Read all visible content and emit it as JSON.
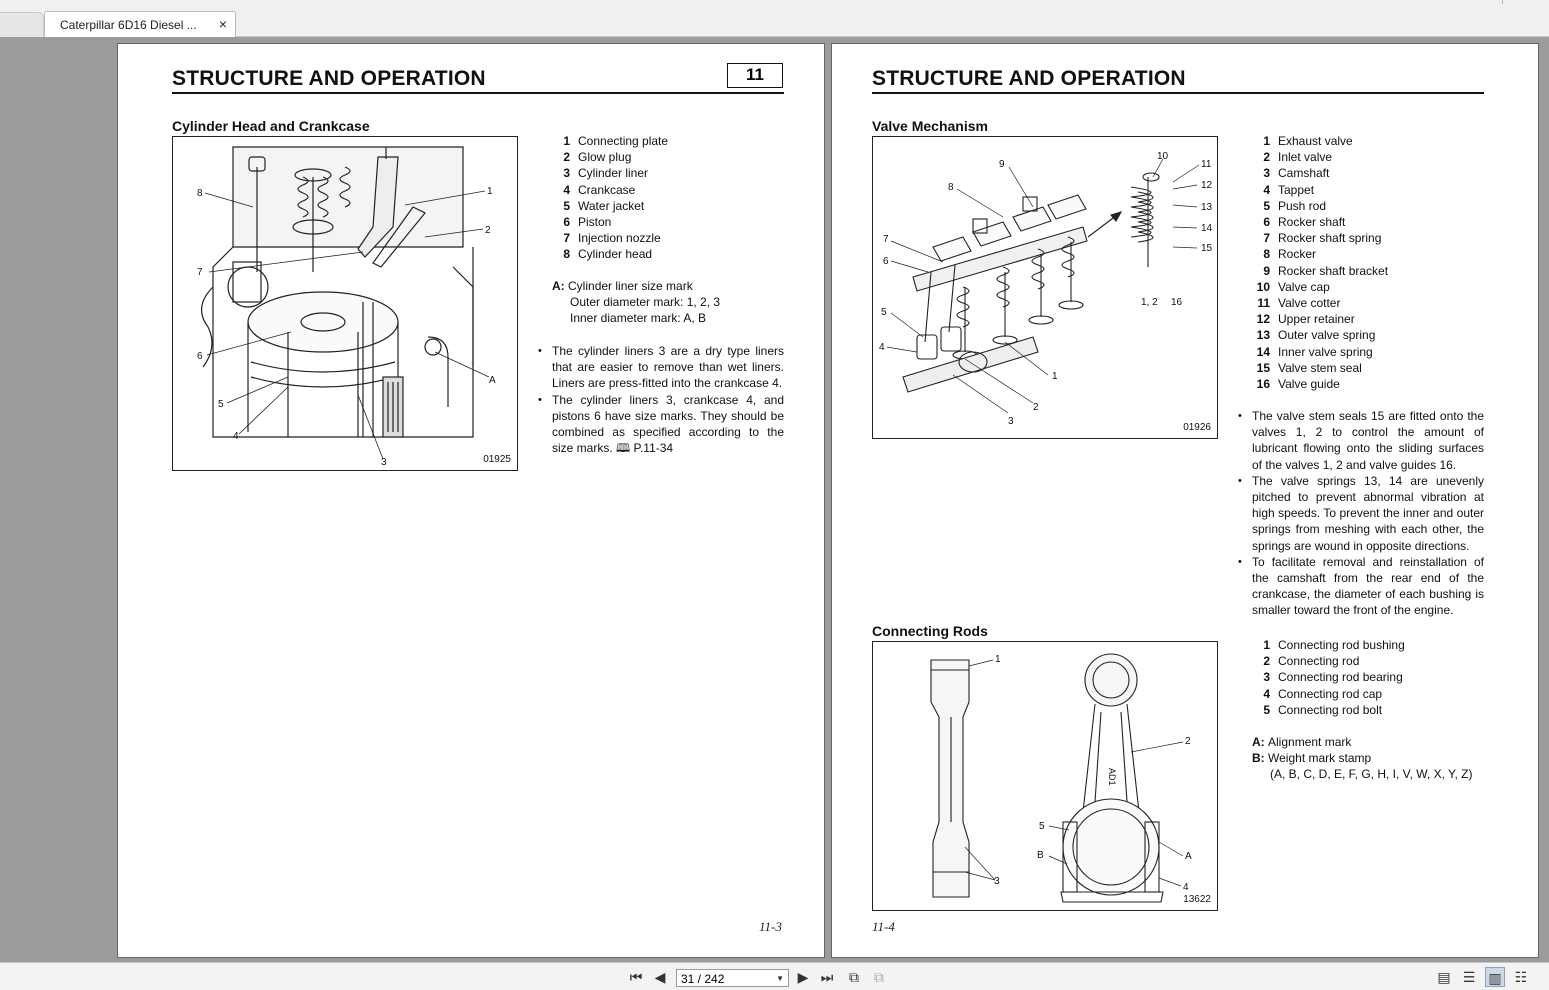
{
  "tab": {
    "title": "Caterpillar 6D16 Diesel ...",
    "close": "×"
  },
  "left_page": {
    "header": "STRUCTURE AND OPERATION",
    "chapter": "11",
    "section_title": "Cylinder Head and Crankcase",
    "figure_number": "01925",
    "legend": [
      {
        "num": "1",
        "label": "Connecting plate"
      },
      {
        "num": "2",
        "label": "Glow plug"
      },
      {
        "num": "3",
        "label": "Cylinder liner"
      },
      {
        "num": "4",
        "label": "Crankcase"
      },
      {
        "num": "5",
        "label": "Water jacket"
      },
      {
        "num": "6",
        "label": "Piston"
      },
      {
        "num": "7",
        "label": "Injection nozzle"
      },
      {
        "num": "8",
        "label": "Cylinder head"
      }
    ],
    "note": {
      "key": "A:",
      "title": "Cylinder liner size mark",
      "line1": "Outer diameter mark: 1, 2, 3",
      "line2": "Inner diameter mark: A, B"
    },
    "bullets": [
      "The cylinder liners 3 are a dry type liners that are easier to remove than wet liners. Liners are press-fitted into the crankcase 4.",
      "The cylinder liners 3, crankcase 4, and pistons 6 have size marks. They should be combined as specified according to the size marks. 🕮 P.11-34"
    ],
    "callouts": [
      "1",
      "2",
      "3",
      "4",
      "5",
      "6",
      "7",
      "8",
      "A"
    ],
    "folio": "11-3"
  },
  "right_page": {
    "header": "STRUCTURE AND OPERATION",
    "section1_title": "Valve Mechanism",
    "figure1_number": "01926",
    "legend1": [
      {
        "num": "1",
        "label": "Exhaust valve"
      },
      {
        "num": "2",
        "label": "Inlet valve"
      },
      {
        "num": "3",
        "label": "Camshaft"
      },
      {
        "num": "4",
        "label": "Tappet"
      },
      {
        "num": "5",
        "label": "Push rod"
      },
      {
        "num": "6",
        "label": "Rocker shaft"
      },
      {
        "num": "7",
        "label": "Rocker shaft spring"
      },
      {
        "num": "8",
        "label": "Rocker"
      },
      {
        "num": "9",
        "label": "Rocker shaft bracket"
      },
      {
        "num": "10",
        "label": "Valve cap"
      },
      {
        "num": "11",
        "label": "Valve cotter"
      },
      {
        "num": "12",
        "label": "Upper retainer"
      },
      {
        "num": "13",
        "label": "Outer valve spring"
      },
      {
        "num": "14",
        "label": "Inner valve spring"
      },
      {
        "num": "15",
        "label": "Valve stem seal"
      },
      {
        "num": "16",
        "label": "Valve guide"
      }
    ],
    "bullets1": [
      "The valve stem seals 15 are fitted onto the valves 1, 2 to control the amount of lubricant flowing onto the sliding surfaces of the valves 1, 2 and valve guides 16.",
      "The valve springs 13, 14 are unevenly pitched to prevent abnormal vibration at high speeds. To prevent the inner and outer springs from meshing with each other, the springs are wound in opposite directions.",
      "To facilitate removal and reinstallation of the camshaft from the rear end of the crankcase, the diameter of each bushing is smaller toward the front of the engine."
    ],
    "callouts1": [
      "1",
      "2",
      "3",
      "4",
      "5",
      "6",
      "7",
      "8",
      "9",
      "10",
      "11",
      "12",
      "13",
      "14",
      "15",
      "1, 2",
      "16"
    ],
    "section2_title": "Connecting Rods",
    "figure2_number": "13622",
    "legend2": [
      {
        "num": "1",
        "label": "Connecting rod bushing"
      },
      {
        "num": "2",
        "label": "Connecting rod"
      },
      {
        "num": "3",
        "label": "Connecting rod bearing"
      },
      {
        "num": "4",
        "label": "Connecting rod cap"
      },
      {
        "num": "5",
        "label": "Connecting rod bolt"
      }
    ],
    "note2": {
      "a_key": "A:",
      "a_label": "Alignment mark",
      "b_key": "B:",
      "b_label": "Weight mark stamp",
      "b_values": "(A, B, C, D, E, F, G, H, I, V, W, X, Y, Z)"
    },
    "callouts2": [
      "1",
      "2",
      "3",
      "4",
      "5",
      "A",
      "B"
    ],
    "rod_stamp": "AD1",
    "folio": "11-4"
  },
  "toolbar": {
    "page_indicator": "31 / 242"
  }
}
